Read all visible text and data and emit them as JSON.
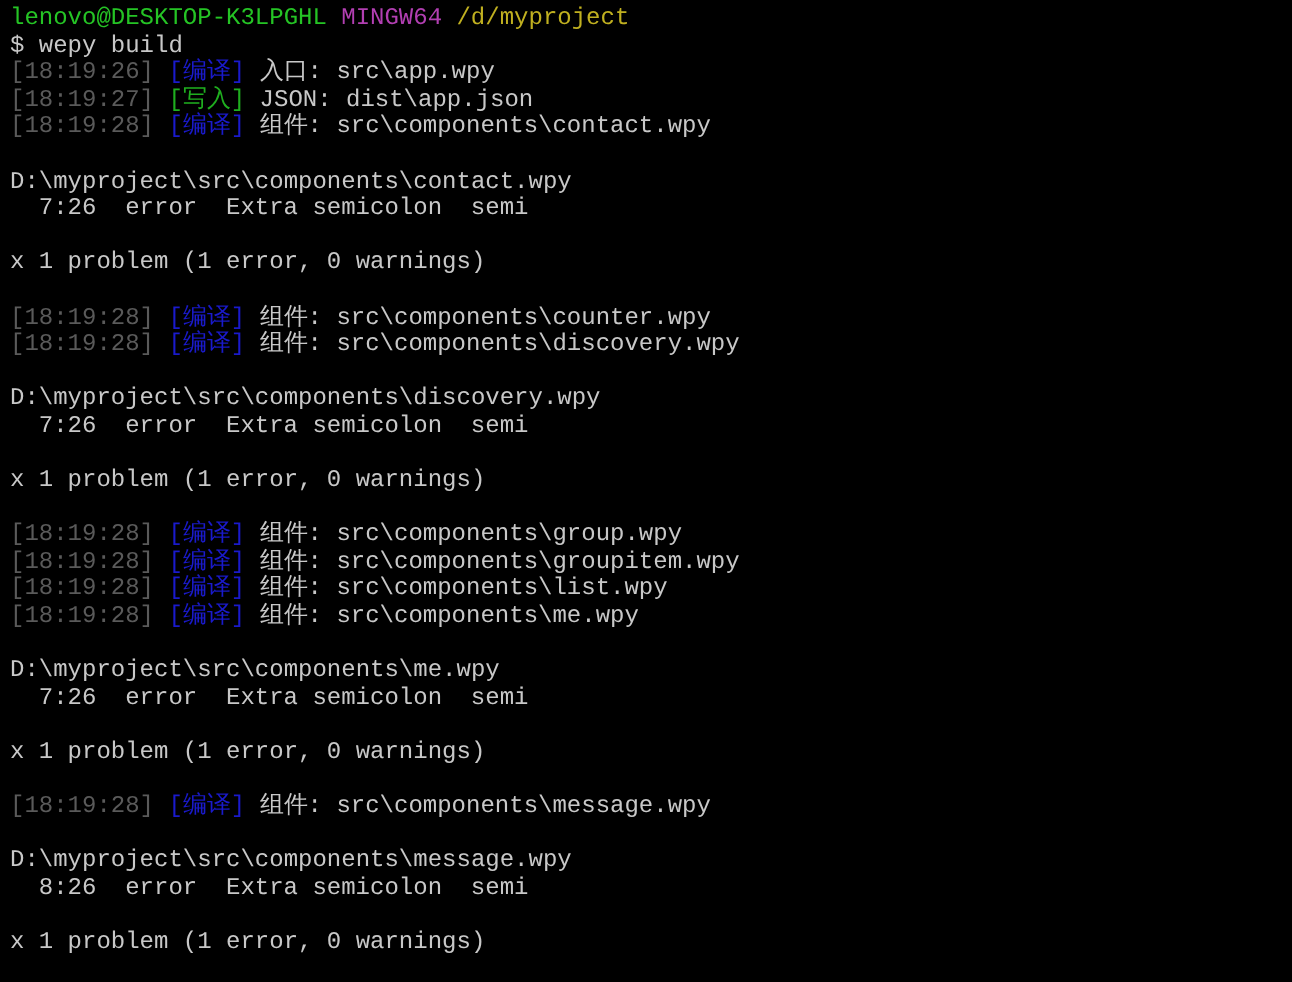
{
  "prompt": {
    "user": "lenovo@DESKTOP-K3LPGHL",
    "system": "MINGW64",
    "path": "/d/myproject"
  },
  "command": "$ wepy build",
  "lines": [
    {
      "kind": "log",
      "time": "[18:19:26]",
      "tag": "[编译]",
      "color": "#1a1acc",
      "message": "入口: src\\app.wpy"
    },
    {
      "kind": "log",
      "time": "[18:19:27]",
      "tag": "[写入]",
      "color": "#1fae1f",
      "message": "JSON: dist\\app.json"
    },
    {
      "kind": "log",
      "time": "[18:19:28]",
      "tag": "[编译]",
      "color": "#1a1acc",
      "message": "组件: src\\components\\contact.wpy"
    },
    {
      "kind": "blank"
    },
    {
      "kind": "file",
      "text": "D:\\myproject\\src\\components\\contact.wpy"
    },
    {
      "kind": "error",
      "position": "7:26",
      "severity": "error",
      "message": "Extra semicolon",
      "rule": "semi"
    },
    {
      "kind": "blank"
    },
    {
      "kind": "summary",
      "text": "x 1 problem (1 error, 0 warnings)"
    },
    {
      "kind": "blank"
    },
    {
      "kind": "log",
      "time": "[18:19:28]",
      "tag": "[编译]",
      "color": "#1a1acc",
      "message": "组件: src\\components\\counter.wpy"
    },
    {
      "kind": "log",
      "time": "[18:19:28]",
      "tag": "[编译]",
      "color": "#1a1acc",
      "message": "组件: src\\components\\discovery.wpy"
    },
    {
      "kind": "blank"
    },
    {
      "kind": "file",
      "text": "D:\\myproject\\src\\components\\discovery.wpy"
    },
    {
      "kind": "error",
      "position": "7:26",
      "severity": "error",
      "message": "Extra semicolon",
      "rule": "semi"
    },
    {
      "kind": "blank"
    },
    {
      "kind": "summary",
      "text": "x 1 problem (1 error, 0 warnings)"
    },
    {
      "kind": "blank"
    },
    {
      "kind": "log",
      "time": "[18:19:28]",
      "tag": "[编译]",
      "color": "#1a1acc",
      "message": "组件: src\\components\\group.wpy"
    },
    {
      "kind": "log",
      "time": "[18:19:28]",
      "tag": "[编译]",
      "color": "#1a1acc",
      "message": "组件: src\\components\\groupitem.wpy"
    },
    {
      "kind": "log",
      "time": "[18:19:28]",
      "tag": "[编译]",
      "color": "#1a1acc",
      "message": "组件: src\\components\\list.wpy"
    },
    {
      "kind": "log",
      "time": "[18:19:28]",
      "tag": "[编译]",
      "color": "#1a1acc",
      "message": "组件: src\\components\\me.wpy"
    },
    {
      "kind": "blank"
    },
    {
      "kind": "file",
      "text": "D:\\myproject\\src\\components\\me.wpy"
    },
    {
      "kind": "error",
      "position": "7:26",
      "severity": "error",
      "message": "Extra semicolon",
      "rule": "semi"
    },
    {
      "kind": "blank"
    },
    {
      "kind": "summary",
      "text": "x 1 problem (1 error, 0 warnings)"
    },
    {
      "kind": "blank"
    },
    {
      "kind": "log",
      "time": "[18:19:28]",
      "tag": "[编译]",
      "color": "#1a1acc",
      "message": "组件: src\\components\\message.wpy"
    },
    {
      "kind": "blank"
    },
    {
      "kind": "file",
      "text": "D:\\myproject\\src\\components\\message.wpy"
    },
    {
      "kind": "error",
      "position": "8:26",
      "severity": "error",
      "message": "Extra semicolon",
      "rule": "semi"
    },
    {
      "kind": "blank"
    },
    {
      "kind": "summary",
      "text": "x 1 problem (1 error, 0 warnings)"
    }
  ]
}
